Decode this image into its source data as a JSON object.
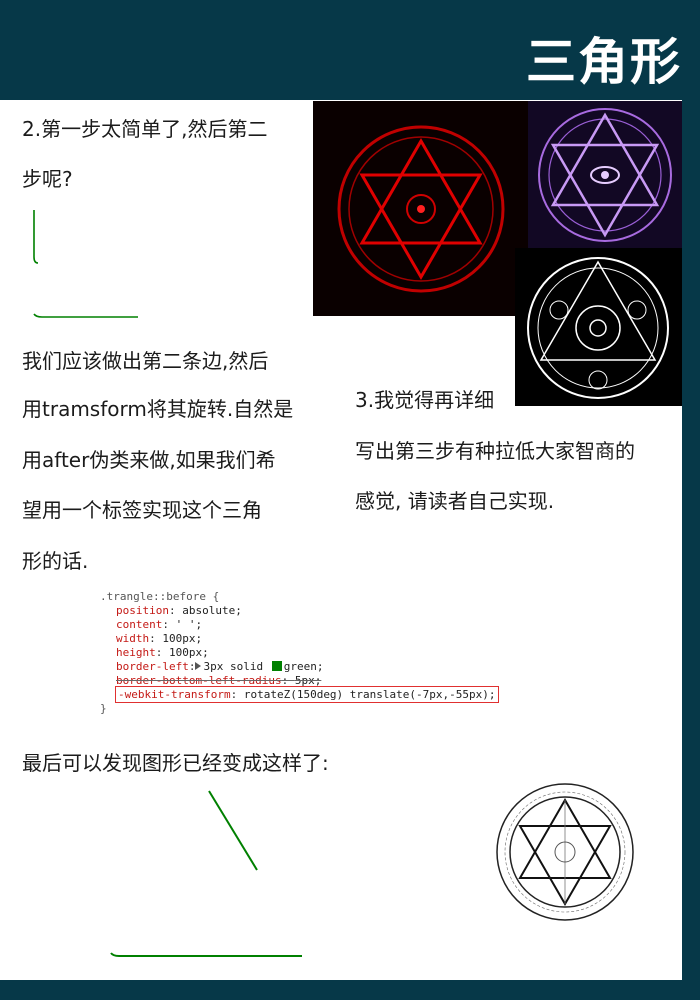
{
  "header": {
    "title": "三角形"
  },
  "section2": {
    "heading_line1": "2.第一步太简单了,然后第二",
    "heading_line2": "步呢?"
  },
  "explanation": {
    "lines": [
      "我们应该做出第二条边,然后",
      "用tramsform将其旋转.自然是",
      "用after伪类来做,如果我们希",
      "望用一个标签实现这个三角",
      "形的话."
    ]
  },
  "section3": {
    "heading": "3.我觉得再详细",
    "line2": "写出第三步有种拉低大家智商的",
    "line3": "感觉, 请读者自己实现."
  },
  "code": {
    "selector": ".trangle::before {",
    "lines": [
      {
        "prop": "position",
        "value": "absolute;"
      },
      {
        "prop": "content",
        "value": "' ';"
      },
      {
        "prop": "width",
        "value": "100px;"
      },
      {
        "prop": "height",
        "value": "100px;"
      },
      {
        "prop": "border-left",
        "value_prefix": "3px solid",
        "value_suffix": "green;"
      },
      {
        "prop": "border-bottom-left-radius",
        "value": "5px;"
      },
      {
        "prop": "-webkit-transform",
        "value": "rotateZ(150deg) translate(-7px,-55px);"
      }
    ],
    "closing": "}"
  },
  "conclusion": {
    "text": "最后可以发现图形已经变成这样了:"
  },
  "colors": {
    "background": "#063848",
    "accent_line": "#008000",
    "highlight_box": "#e03030"
  },
  "images": [
    {
      "name": "red-hexagram-circle-image"
    },
    {
      "name": "purple-hexagram-circle-image"
    },
    {
      "name": "white-alchemy-circle-image"
    },
    {
      "name": "bw-hexagram-circle-image"
    }
  ]
}
